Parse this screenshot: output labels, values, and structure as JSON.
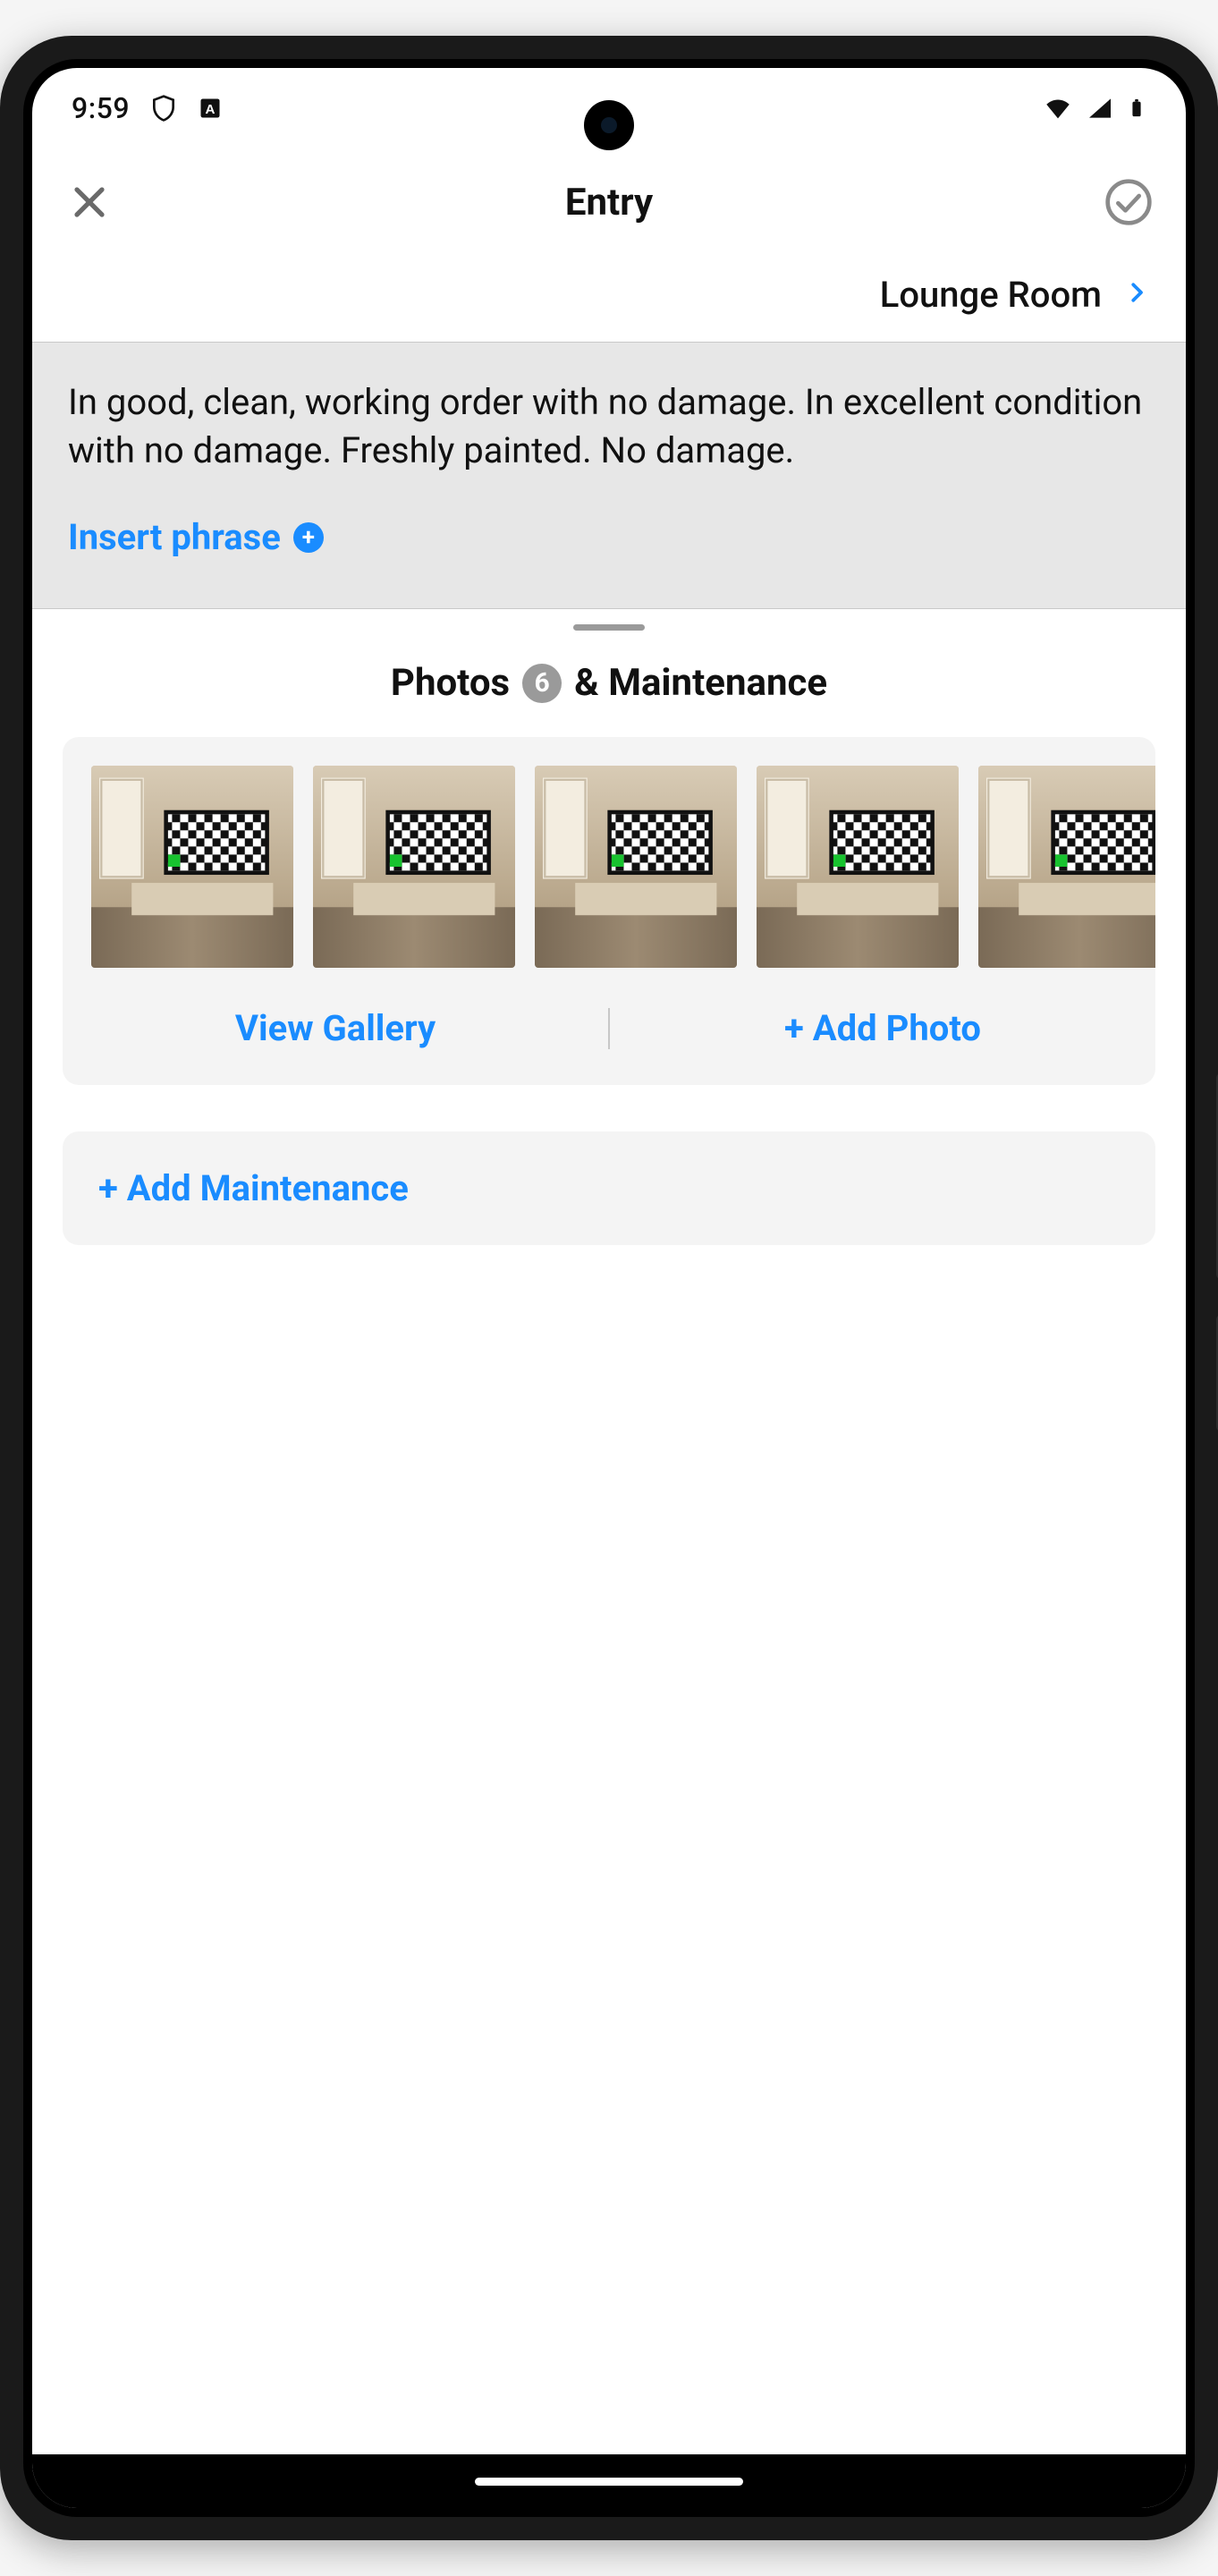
{
  "status": {
    "time": "9:59"
  },
  "appbar": {
    "title": "Entry"
  },
  "roomnav": {
    "next_room": "Lounge Room"
  },
  "description": {
    "text": "In good, clean, working order with no damage. In excellent condition with no damage. Freshly painted. No damage.",
    "insert_phrase_label": "Insert phrase"
  },
  "photos": {
    "header_prefix": "Photos",
    "count": "6",
    "header_suffix": "& Maintenance",
    "view_gallery_label": "View Gallery",
    "add_photo_label": "+ Add Photo",
    "thumbnails_visible": 5
  },
  "maintenance": {
    "add_label": "+ Add Maintenance"
  },
  "icons": {
    "close": "close-icon",
    "confirm": "check-circle-icon",
    "chevron_right": "chevron-right-icon",
    "shield": "shield-icon",
    "wifi": "wifi-icon",
    "signal": "cellular-signal-icon",
    "battery": "battery-icon",
    "plus_circle": "plus-circle-icon"
  },
  "colors": {
    "accent": "#1a8cff",
    "muted_bg": "#e7e7e7",
    "card_bg": "#f4f4f4",
    "badge_bg": "#9a9a9a"
  }
}
